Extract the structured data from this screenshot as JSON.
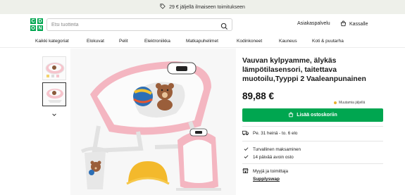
{
  "promo": {
    "text": "29 € jäljellä ilmaiseen toimitukseen",
    "icon": "tag-icon"
  },
  "header": {
    "logo_letters": [
      "C",
      "D",
      "O",
      "N"
    ],
    "search_placeholder": "Etsi tuotteita",
    "customer_service": "Asiakaspalvelu",
    "cart_label": "Kassalle"
  },
  "nav": {
    "items": [
      "Kaikki kategoriat",
      "Elokuvat",
      "Pelit",
      "Elektroniikka",
      "Matkapuhelimet",
      "Kodinkoneet",
      "Kauneus",
      "Koti & puutarha"
    ]
  },
  "product": {
    "title": "Vauvan kylpyamme, älykäs lämpötilasensori, taitettava muotoilu,Tyyppi 2 Vaaleanpunainen",
    "price": "89,88 €",
    "stock_label": "Muutamia jäljellä",
    "buy_label": "Lisää ostoskoriin",
    "delivery": "Pe. 31 heinä - to. 6 elo",
    "benefits": [
      "Turvallinen maksaminen",
      "14 päivää avoin osto"
    ],
    "seller_label": "Myyjä ja toimittaja",
    "seller_name": "Supplyswap"
  },
  "colors": {
    "brand_green": "#00a650",
    "tub_pink": "#f2b3bd",
    "stock_yellow": "#e9b12f"
  }
}
